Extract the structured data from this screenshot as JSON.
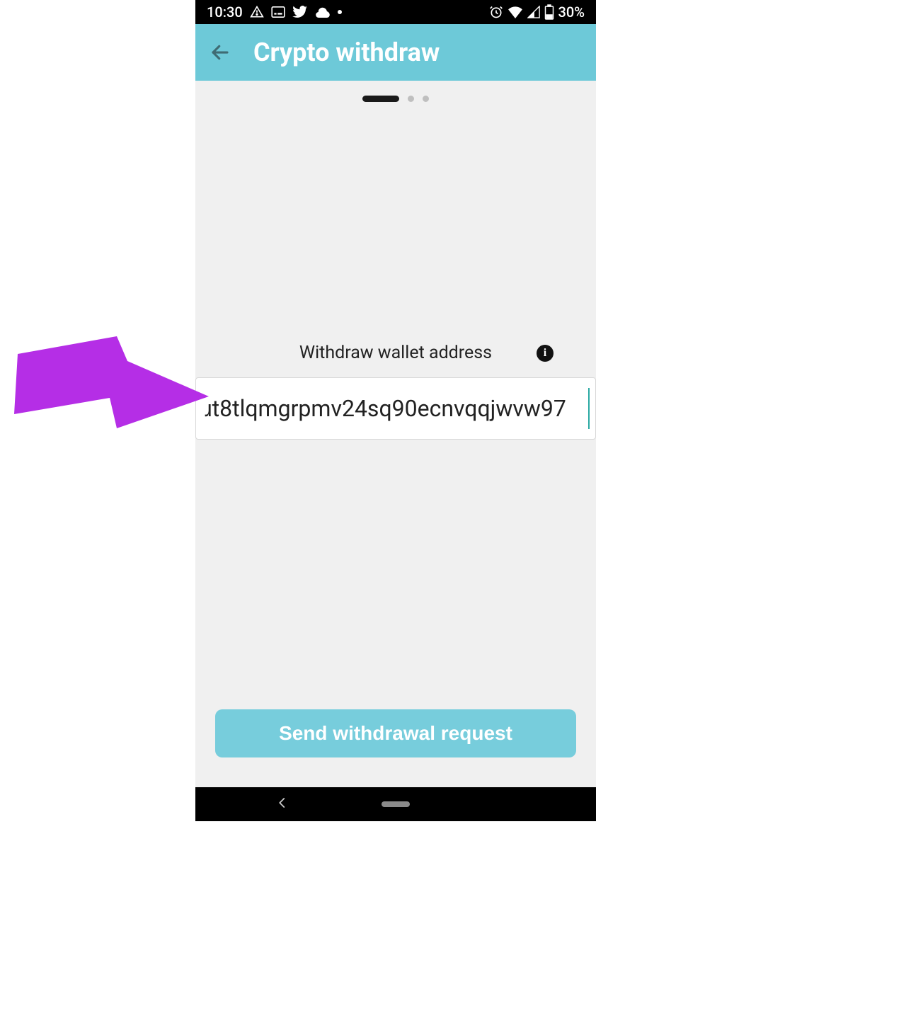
{
  "statusbar": {
    "time": "10:30",
    "battery_text": "30%"
  },
  "header": {
    "title": "Crypto withdraw"
  },
  "form": {
    "address_label": "Withdraw wallet address",
    "address_value": "ɹt8tlqmgrpmv24sq90ecnvqqjwvw97"
  },
  "actions": {
    "submit_label": "Send withdrawal request"
  },
  "colors": {
    "header_bg": "#6dc9d8",
    "button_bg": "#77cddc",
    "annotation_arrow": "#b52ee6"
  }
}
